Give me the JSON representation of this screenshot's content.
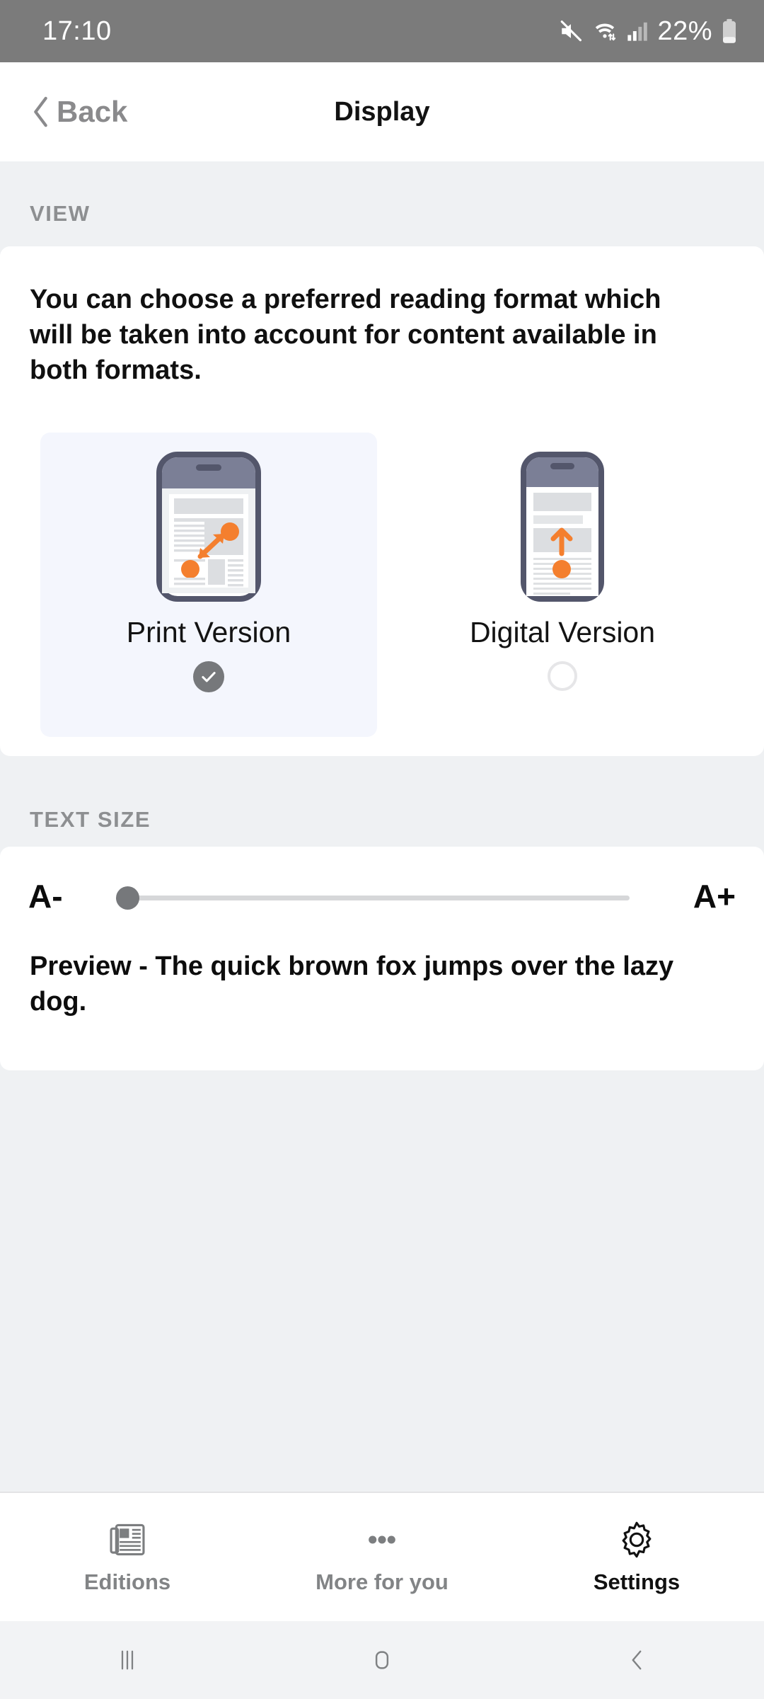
{
  "statusbar": {
    "time": "17:10",
    "battery_percent": "22%",
    "icons": [
      "mute-icon",
      "wifi-icon",
      "cellular-signal-icon",
      "battery-icon"
    ]
  },
  "header": {
    "back_label": "Back",
    "title": "Display"
  },
  "sections": {
    "view": {
      "header": "VIEW",
      "description": "You can choose a preferred reading format which will be taken into account for content available in both formats.",
      "options": [
        {
          "label": "Print Version",
          "selected": true,
          "icon": "phone-print-layout-icon"
        },
        {
          "label": "Digital Version",
          "selected": false,
          "icon": "phone-digital-layout-icon"
        }
      ]
    },
    "text_size": {
      "header": "TEXT SIZE",
      "decrease_label": "A-",
      "increase_label": "A+",
      "slider_value": 0,
      "preview": "Preview - The quick brown fox jumps over the lazy dog."
    }
  },
  "tabbar": {
    "tabs": [
      {
        "label": "Editions",
        "icon": "newspaper-icon",
        "active": false
      },
      {
        "label": "More for you",
        "icon": "ellipsis-icon",
        "active": false
      },
      {
        "label": "Settings",
        "icon": "gear-icon",
        "active": true
      }
    ]
  },
  "android_nav": {
    "keys": [
      "recents-icon",
      "home-icon",
      "back-icon"
    ]
  },
  "colors": {
    "accent_orange": "#f47f2e",
    "selected_card_bg": "#f4f6fd",
    "page_bg": "#eff1f3",
    "muted_gray": "#8a8a8c"
  }
}
